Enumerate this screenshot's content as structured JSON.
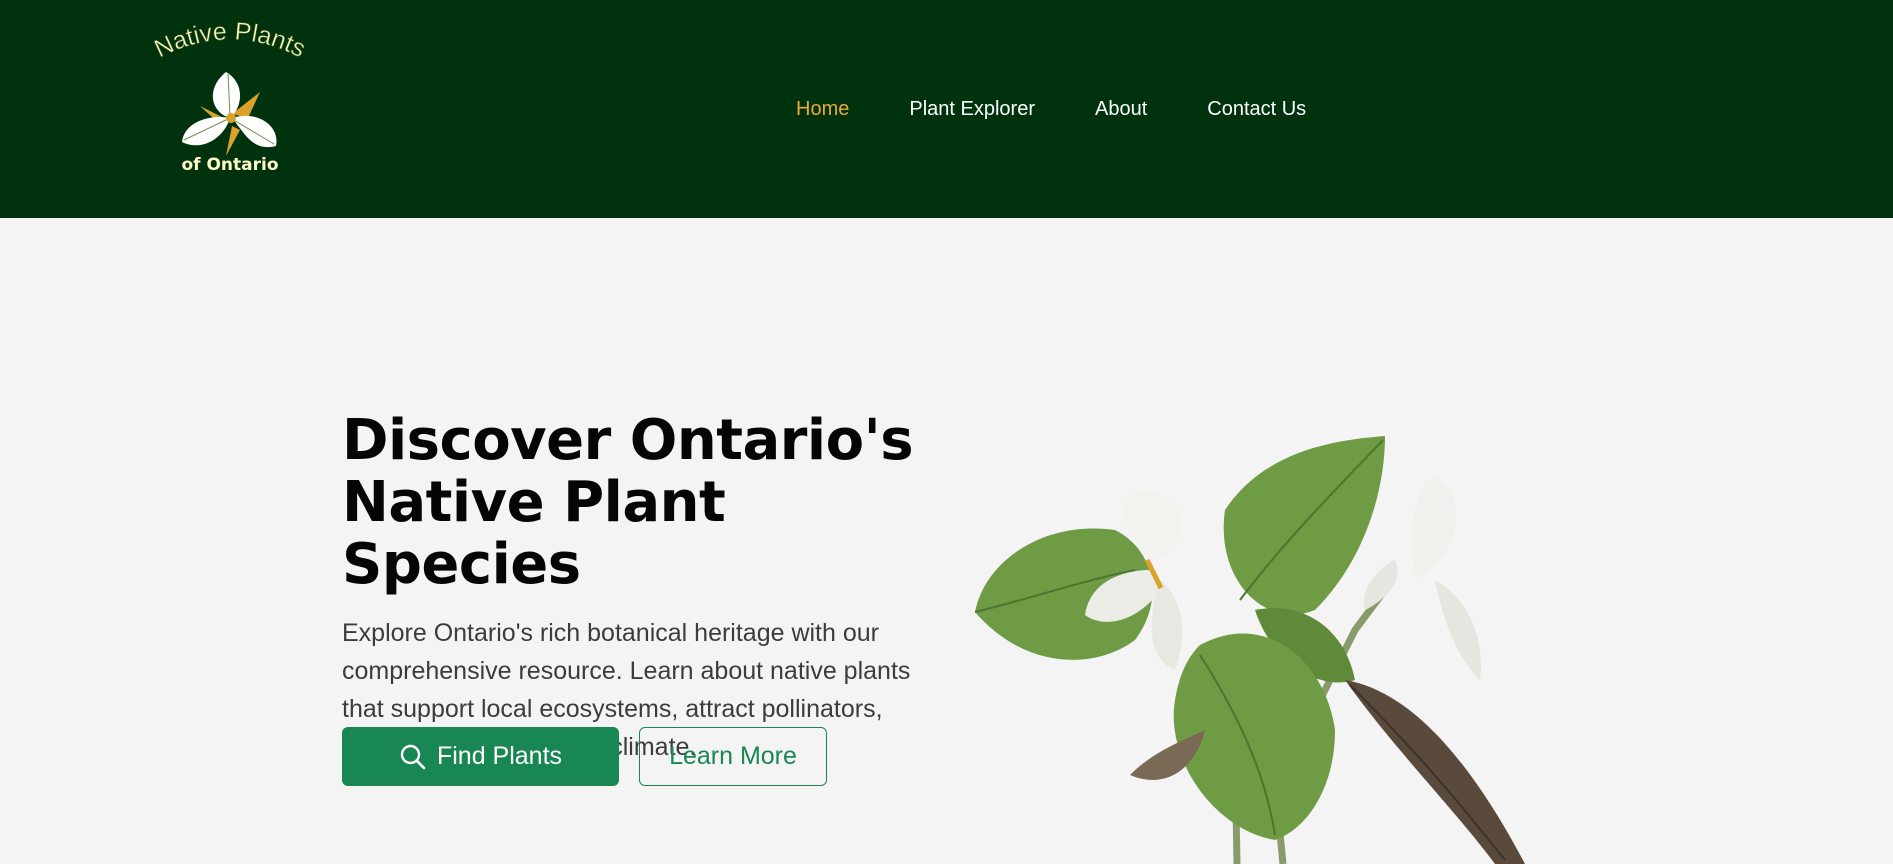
{
  "logo": {
    "line1": "Native Plants",
    "line2": "of Ontario"
  },
  "nav": {
    "items": [
      {
        "label": "Home",
        "active": true
      },
      {
        "label": "Plant Explorer",
        "active": false
      },
      {
        "label": "About",
        "active": false
      },
      {
        "label": "Contact Us",
        "active": false
      }
    ]
  },
  "hero": {
    "title_line1": "Discover Ontario's",
    "title_line2": "Native Plant Species",
    "description": "Explore Ontario's rich botanical heritage with our comprehensive resource. Learn about native plants that support local ecosystems, attract pollinators, and thrive in our unique climate.",
    "find_button": "Find Plants",
    "learn_button": "Learn More"
  },
  "colors": {
    "header_bg": "#00330d",
    "nav_active": "#e8a838",
    "primary": "#198754",
    "page_bg": "#f4f4f4"
  },
  "icons": {
    "find_button_icon": "search-icon",
    "logo_icon": "trillium-flower-icon",
    "hero_image": "trillium-plant-illustration"
  }
}
